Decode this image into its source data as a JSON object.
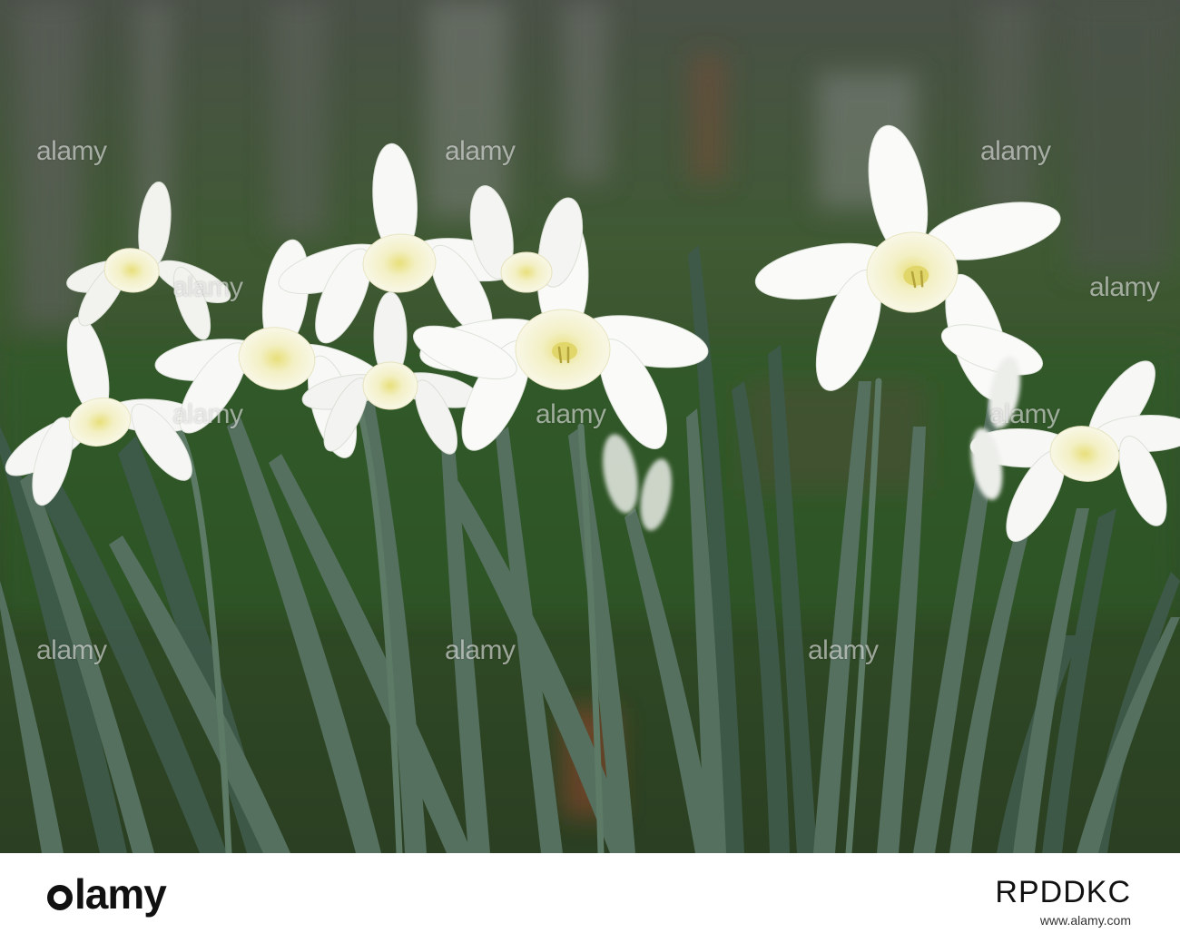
{
  "image": {
    "subject": "white daffodils",
    "background_color": "#3e5535",
    "petal_color": "#f7f8f5",
    "cup_color": "#f2f1cf",
    "leaf_color": "#4e6a55"
  },
  "watermark": {
    "text": "alamy"
  },
  "footer": {
    "logo_text": "lamy",
    "image_id": "RPDDKC",
    "caption": "www.alamy.com"
  }
}
